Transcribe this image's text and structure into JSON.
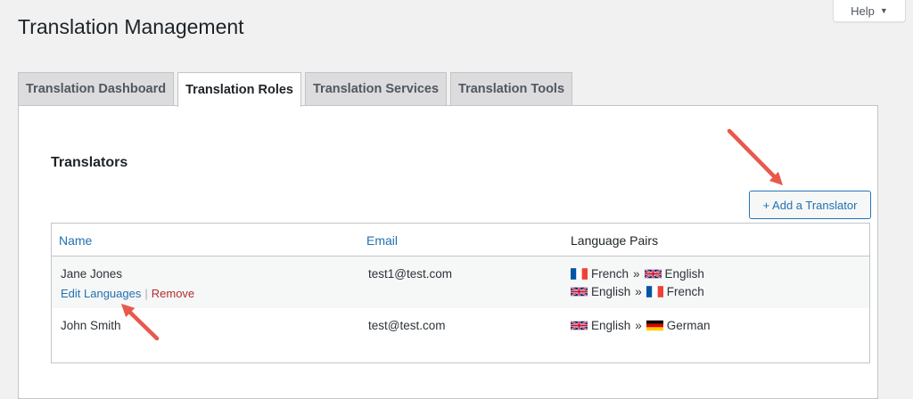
{
  "header": {
    "title": "Translation Management",
    "help_label": "Help"
  },
  "tabs": [
    {
      "label": "Translation Dashboard",
      "active": false
    },
    {
      "label": "Translation Roles",
      "active": true
    },
    {
      "label": "Translation Services",
      "active": false
    },
    {
      "label": "Translation Tools",
      "active": false
    }
  ],
  "section": {
    "title": "Translators",
    "add_button": "+ Add a Translator"
  },
  "table": {
    "columns": [
      "Name",
      "Email",
      "Language Pairs"
    ],
    "rows": [
      {
        "name": "Jane Jones",
        "email": "test1@test.com",
        "actions": {
          "edit": "Edit Languages",
          "remove": "Remove"
        },
        "pairs": [
          {
            "from": "French",
            "to": "English",
            "from_flag": "fr-flag",
            "to_flag": "gb-flag"
          },
          {
            "from": "English",
            "to": "French",
            "from_flag": "gb-flag",
            "to_flag": "fr-flag"
          }
        ]
      },
      {
        "name": "John Smith",
        "email": "test@test.com",
        "pairs": [
          {
            "from": "English",
            "to": "German",
            "from_flag": "gb-flag",
            "to_flag": "de-flag"
          }
        ]
      }
    ]
  },
  "pair_separator": "»",
  "colors": {
    "accent": "#2271b1",
    "annotation_arrow": "#e8594b",
    "remove": "#b32d2e"
  }
}
